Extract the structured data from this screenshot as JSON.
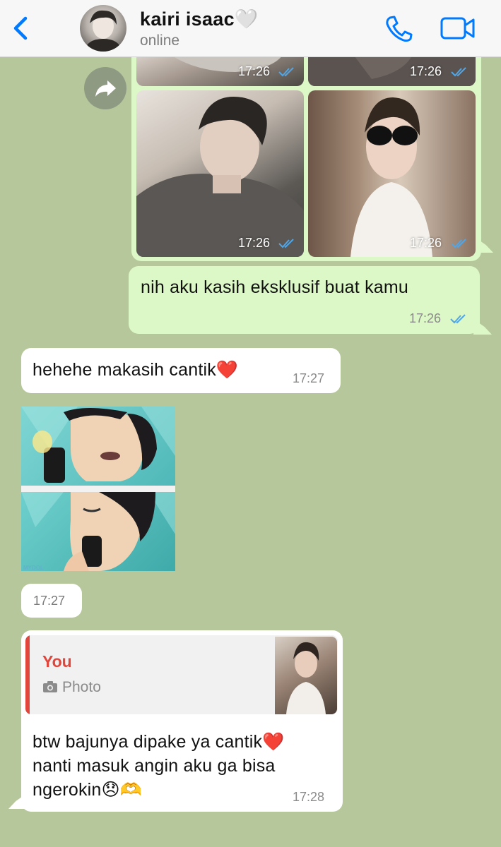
{
  "header": {
    "contact_name": "kairi isaac🤍",
    "status": "online"
  },
  "colors": {
    "accent_blue": "#007aff",
    "chat_bg": "#b7c79c",
    "outgoing_bubble": "#dcf8c6",
    "incoming_bubble": "#ffffff",
    "reply_accent": "#e0463b",
    "read_ticks": "#4fa6e8"
  },
  "icons": {
    "back": "chevron-left-icon",
    "call": "phone-icon",
    "video": "video-camera-icon",
    "forward": "forward-arrow-icon",
    "ticks": "double-check-icon",
    "camera": "camera-icon",
    "heart_emoji": "❤️",
    "sad_emoji": "😞",
    "heart_hands_emoji": "🫶"
  },
  "messages": {
    "photo_grid_times": [
      "17:26",
      "17:26",
      "17:26",
      "17:26"
    ],
    "out_text": "nih aku kasih eksklusif buat kamu",
    "out_time": "17:26",
    "in_text_1": "hehehe makasih cantik❤️",
    "in_time_1": "17:27",
    "sticker_label": "MYDOL",
    "sticker_time": "17:27",
    "reply": {
      "author": "You",
      "type": "Photo"
    },
    "in_text_2_line1": "btw bajunya dipake ya cantik❤️",
    "in_text_2_line2": "nanti masuk angin aku ga bisa",
    "in_text_2_line3": "ngerokin😞🫶",
    "in_time_2": "17:28"
  }
}
